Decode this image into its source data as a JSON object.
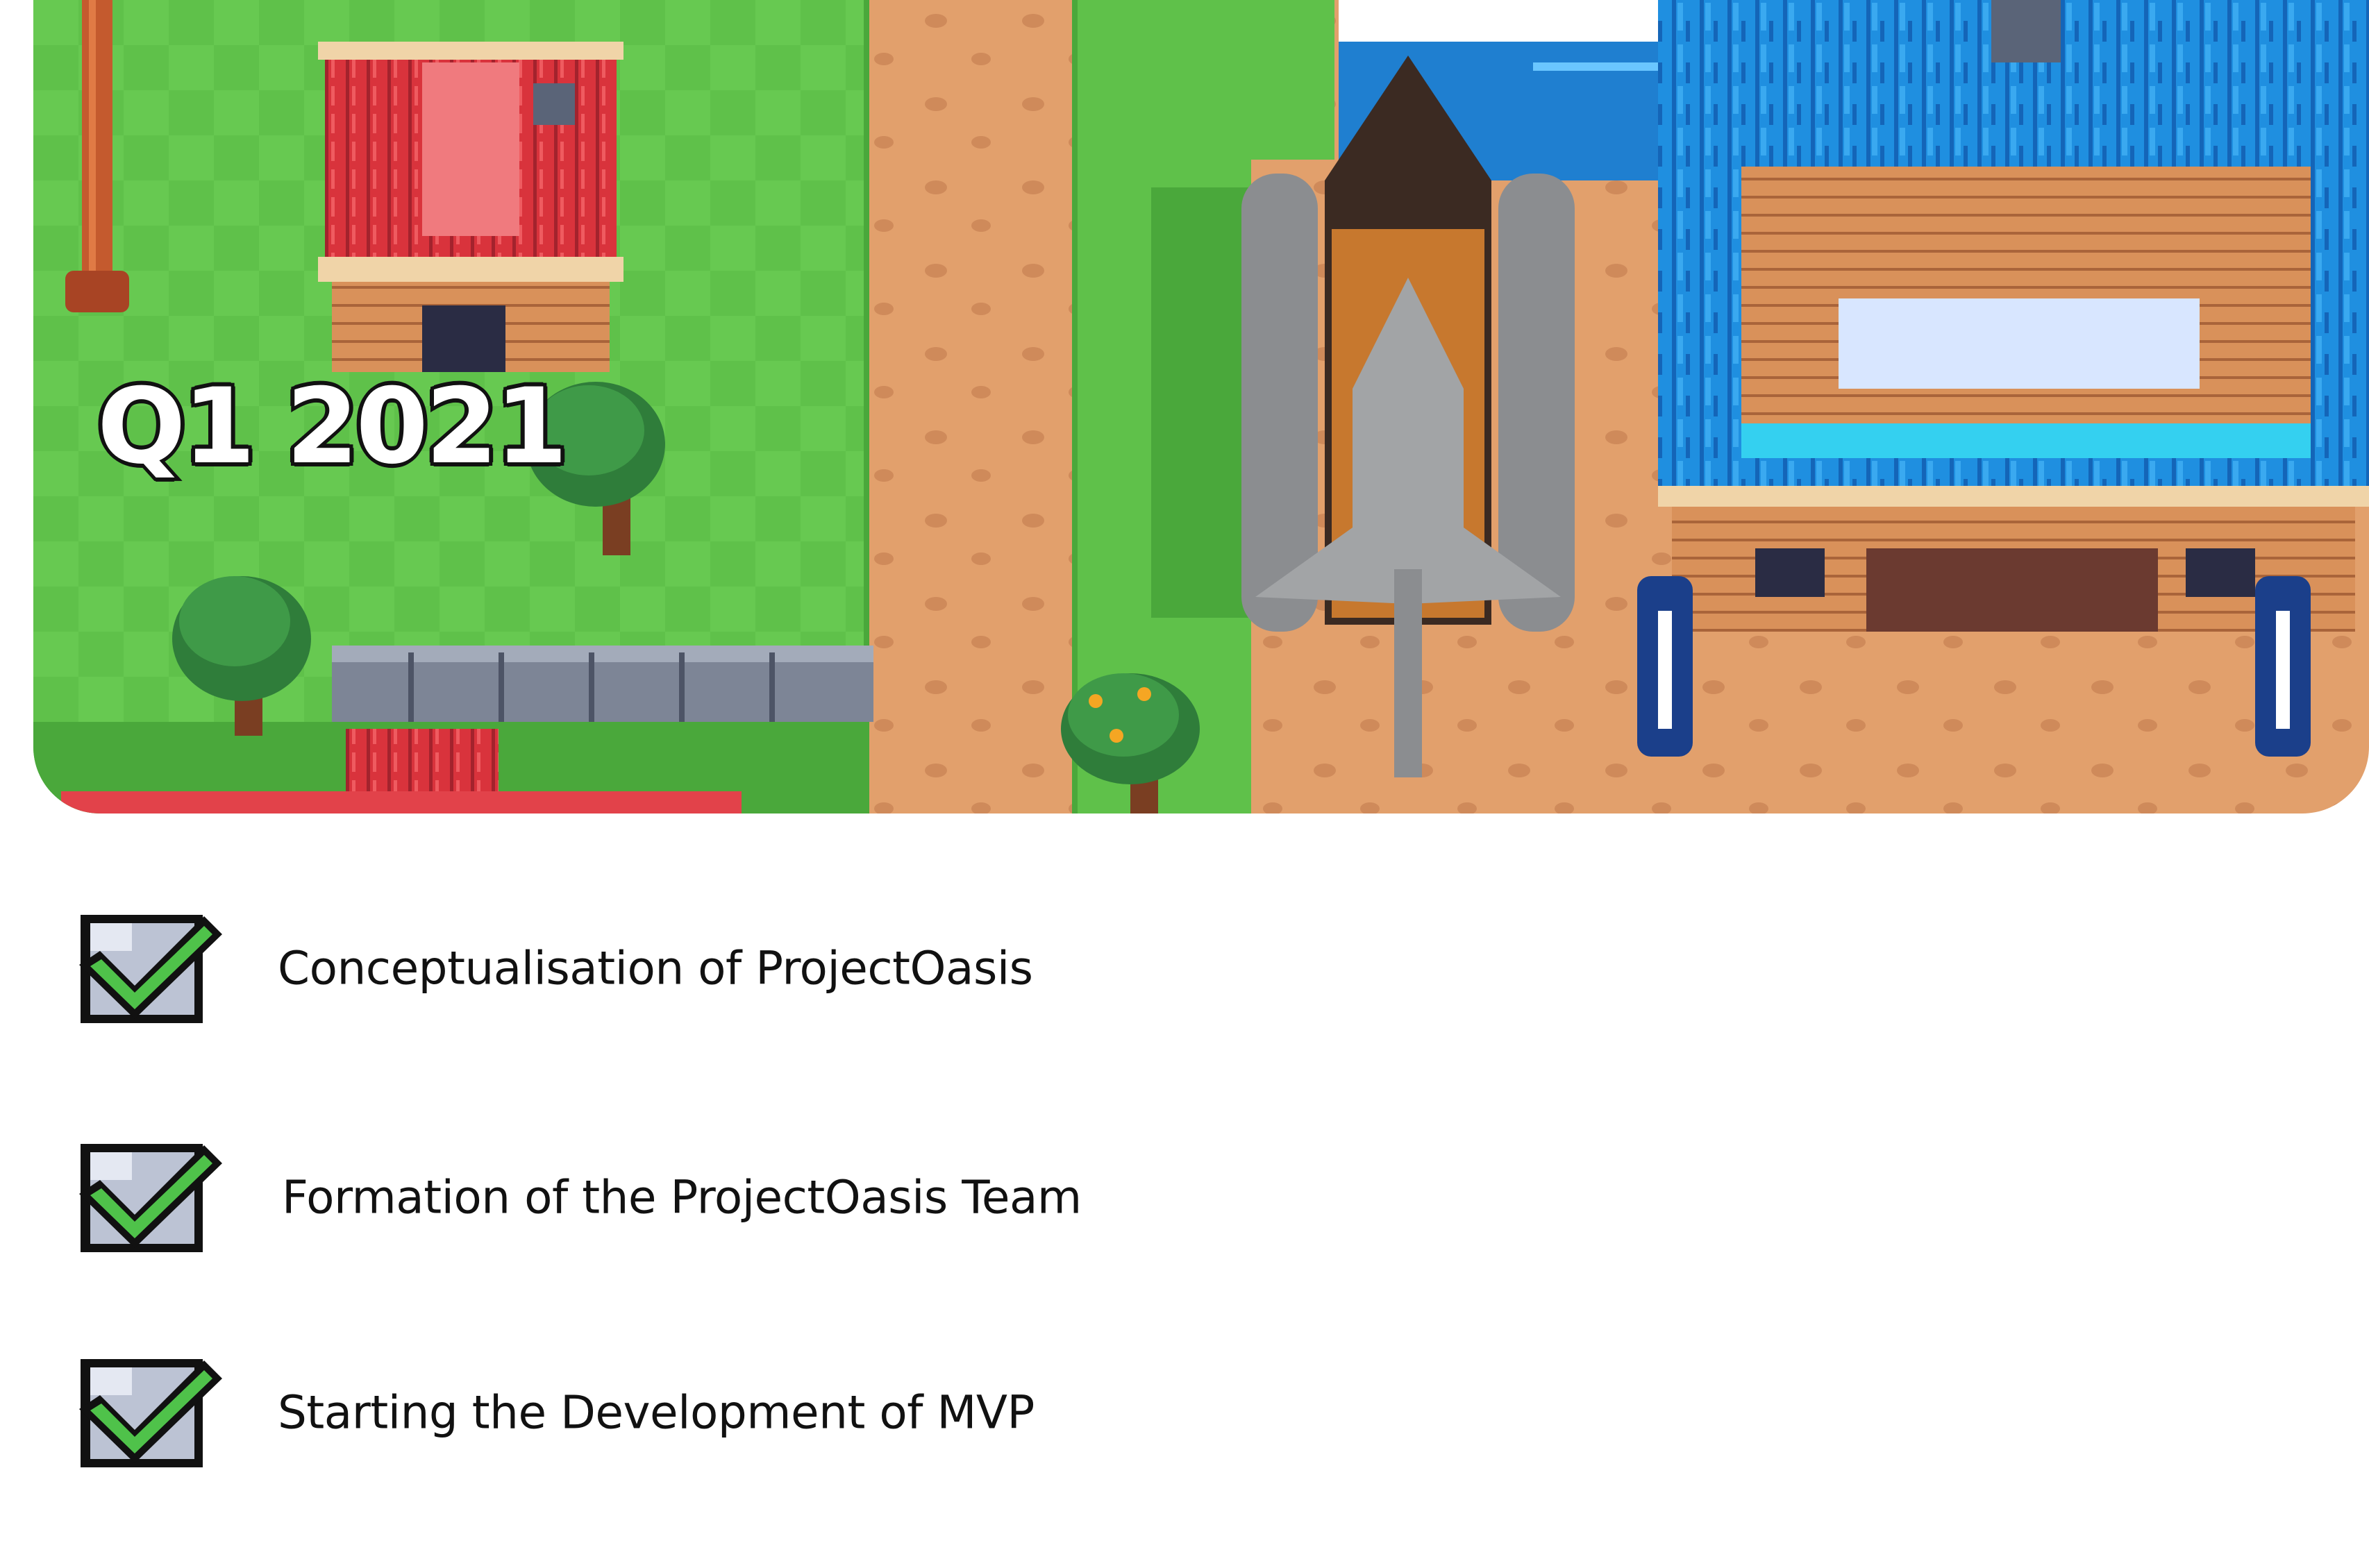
{
  "quarter": "Q1 2021",
  "scene": {
    "description_icons": [
      "barn-icon",
      "space-shuttle-icon",
      "hangar-icon",
      "tree-icon",
      "fence-icon",
      "lamp-post-icon"
    ]
  },
  "checklist": {
    "items": [
      {
        "label": "Conceptualisation of ProjectOasis",
        "done": true
      },
      {
        "label": "Formation of the ProjectOasis Team",
        "done": true
      },
      {
        "label": "Starting the Development of MVP",
        "done": true
      }
    ]
  },
  "colors": {
    "grass": "#5fc14a",
    "grass_dark": "#4aa83b",
    "dirt": "#e2a06c",
    "check_green": "#4fc24a",
    "roof_blue": "#1f8fe0",
    "roof_red": "#e2424a"
  }
}
